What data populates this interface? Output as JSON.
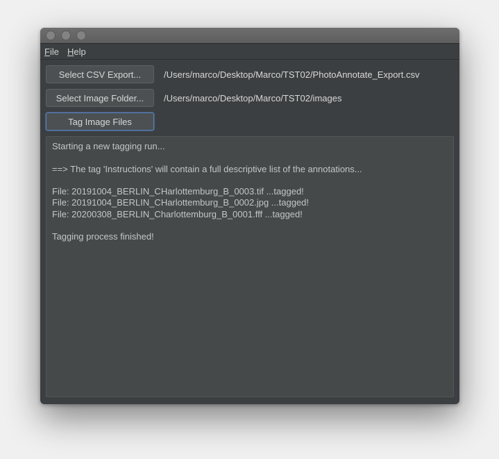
{
  "menubar": {
    "file": "File",
    "help": "Help"
  },
  "buttons": {
    "select_csv": "Select CSV Export...",
    "select_folder": "Select Image Folder...",
    "tag_files": "Tag Image Files"
  },
  "paths": {
    "csv": "/Users/marco/Desktop/Marco/TST02/PhotoAnnotate_Export.csv",
    "folder": "/Users/marco/Desktop/Marco/TST02/images"
  },
  "log": "Starting a new tagging run...\n\n==> The tag 'Instructions' will contain a full descriptive list of the annotations...\n\nFile: 20191004_BERLIN_CHarlottemburg_B_0003.tif ...tagged!\nFile: 20191004_BERLIN_CHarlottemburg_B_0002.jpg ...tagged!\nFile: 20200308_BERLIN_Charlottemburg_B_0001.fff ...tagged!\n\nTagging process finished!"
}
